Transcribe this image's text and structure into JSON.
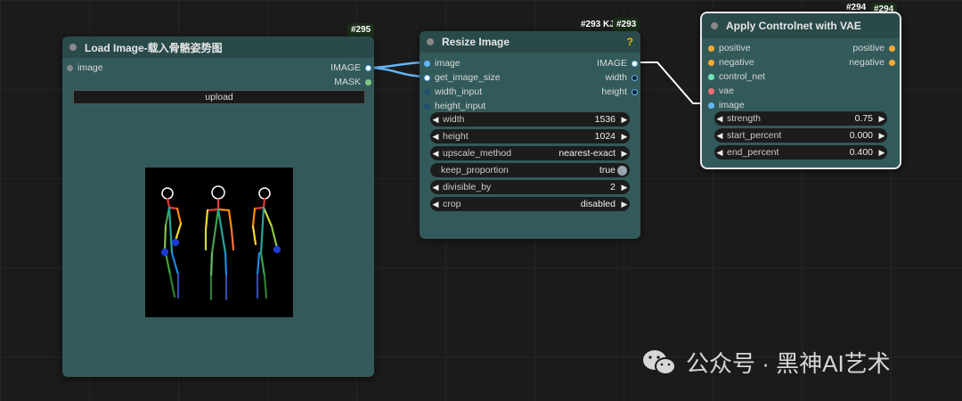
{
  "colors": {
    "canvas": "#1b1b1b",
    "node_body": "#335a5a",
    "node_header": "#2a4a4a",
    "link_image": "#64b5f6",
    "link_white": "#ffffff",
    "port_conditioning": "#ffa931",
    "port_controlnet": "#6ee7b7",
    "port_vae": "#ff6e6e",
    "port_image": "#64b5f6"
  },
  "load_image": {
    "id": "#295",
    "title": "Load Image-载入骨骼姿势图",
    "input_label": "image",
    "outputs": [
      "IMAGE",
      "MASK"
    ],
    "upload_label": "upload"
  },
  "resize_image": {
    "badge_left": "#293 KJ",
    "id": "#293",
    "title": "Resize Image",
    "help": "?",
    "inputs": [
      "image",
      "get_image_size",
      "width_input",
      "height_input"
    ],
    "outputs": [
      "IMAGE",
      "width",
      "height"
    ],
    "widgets": [
      {
        "label": "width",
        "value": "1536"
      },
      {
        "label": "height",
        "value": "1024"
      },
      {
        "label": "upscale_method",
        "value": "nearest-exact"
      },
      {
        "label": "keep_proportion",
        "value": "true"
      },
      {
        "label": "divisible_by",
        "value": "2"
      },
      {
        "label": "crop",
        "value": "disabled"
      }
    ]
  },
  "apply_controlnet": {
    "badge_left": "#294",
    "id": "#294",
    "title": "Apply Controlnet with VAE",
    "inputs": [
      "positive",
      "negative",
      "control_net",
      "vae",
      "image"
    ],
    "outputs": [
      "positive",
      "negative"
    ],
    "widgets": [
      {
        "label": "strength",
        "value": "0.75"
      },
      {
        "label": "start_percent",
        "value": "0.000"
      },
      {
        "label": "end_percent",
        "value": "0.400"
      }
    ]
  },
  "watermark": {
    "text": "公众号 · 黑神AI艺术",
    "icon": "wechat-icon"
  }
}
